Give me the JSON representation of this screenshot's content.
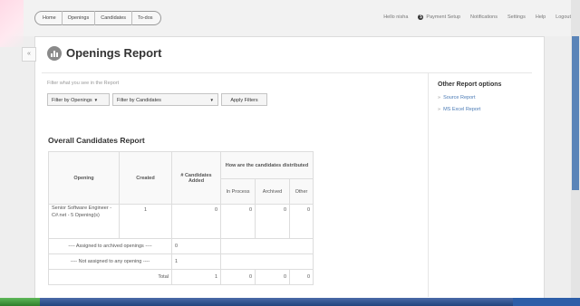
{
  "nav": {
    "links": [
      "Home",
      "Openings",
      "Candidates",
      "To-dos"
    ],
    "right": {
      "greeting": "Hello nisha",
      "payment_setup": "Payment Setup",
      "notifications": "Notifications",
      "settings": "Settings",
      "help": "Help",
      "logout": "Logout"
    }
  },
  "page": {
    "title": "Openings Report",
    "collapse_glyph": "«"
  },
  "filters": {
    "hint": "Filter what you see in the Report",
    "openings_label": "Filter by Openings",
    "candidates_label": "Filter by Candidates",
    "apply_label": "Apply Filters"
  },
  "sidebar": {
    "title": "Other Report options",
    "links": [
      "Source Report",
      "MS Excel Report"
    ]
  },
  "report": {
    "title": "Overall Candidates Report",
    "headers": {
      "opening": "Opening",
      "created": "Created",
      "added": "# Candidates Added",
      "distributed": "How are the candidates distributed",
      "in_process": "In Process",
      "archived": "Archived",
      "other": "Other"
    },
    "row": {
      "opening": "Senior Software Engineer - C#.net - 5 Opening(s)",
      "created": "1",
      "added": "0",
      "in_process": "0",
      "archived": "0",
      "other": "0"
    },
    "archived_row": {
      "label": "---- Assigned to archived openings ----",
      "added": "0"
    },
    "unassigned_row": {
      "label": "---- Not assigned to any opening ----",
      "added": "1"
    },
    "total_row": {
      "label": "Total",
      "added": "1",
      "in_process": "0",
      "archived": "0",
      "other": "0"
    }
  },
  "icons": {
    "report_icon": "bar-chart-icon",
    "payment_icon": "dollar-circle-icon",
    "collapse_icon": "double-chevron-left-icon"
  }
}
